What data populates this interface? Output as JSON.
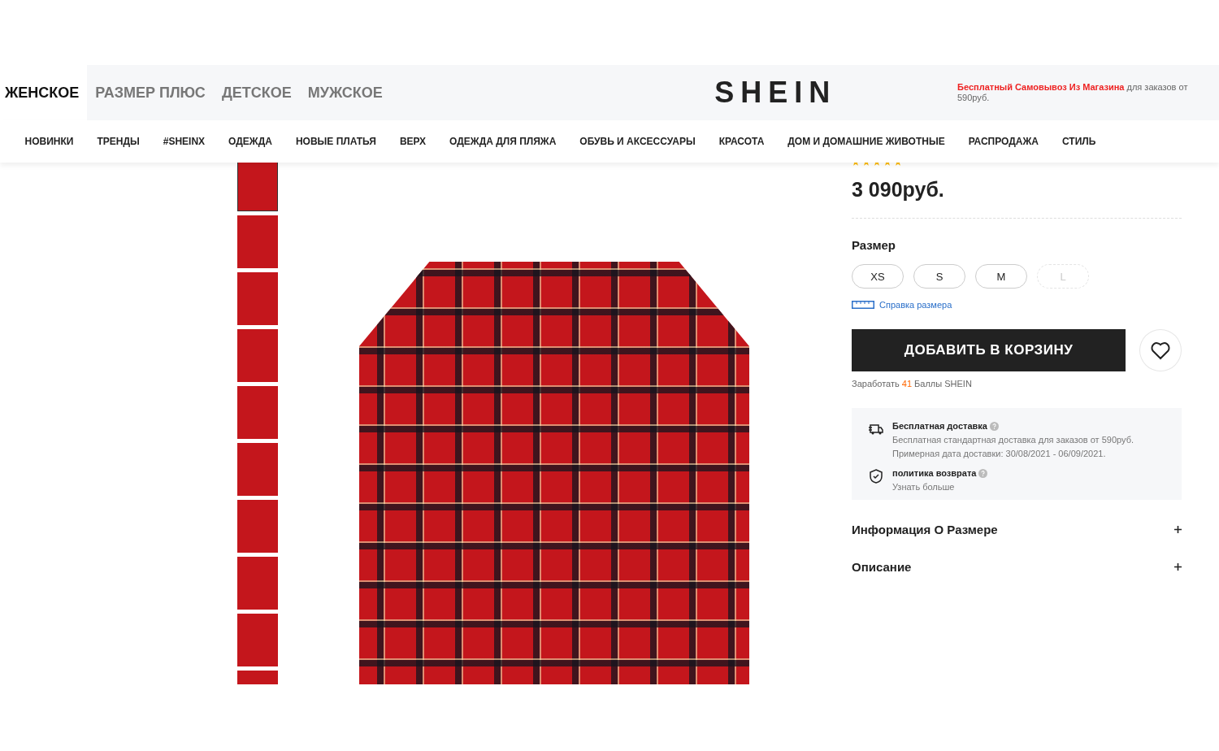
{
  "header": {
    "channels": [
      {
        "label": "ЖЕНСКОЕ",
        "selected": true
      },
      {
        "label": "РАЗМЕР ПЛЮС",
        "selected": false
      },
      {
        "label": "ДЕТСКОЕ",
        "selected": false
      },
      {
        "label": "МУЖСКОЕ",
        "selected": false
      }
    ],
    "logo": "SHEIN",
    "promo": {
      "highlight": "Бесплатный Самовывоз Из Магазина",
      "text": "для заказов от 590руб."
    }
  },
  "nav": [
    "НОВИНКИ",
    "ТРЕНДЫ",
    "#SHEINX",
    "ОДЕЖДА",
    "НОВЫЕ ПЛАТЬЯ",
    "ВЕРХ",
    "ОДЕЖДА ДЛЯ ПЛЯЖА",
    "ОБУВЬ И АКСЕССУАРЫ",
    "КРАСОТА",
    "ДОМ И ДОМАШНИЕ ЖИВОТНЫЕ",
    "РАСПРОДАЖА",
    "СТИЛЬ"
  ],
  "gallery": {
    "thumbnails": [
      {
        "selected": true
      },
      {
        "selected": false
      },
      {
        "selected": false
      },
      {
        "selected": false
      },
      {
        "selected": false
      },
      {
        "selected": false
      },
      {
        "selected": false
      },
      {
        "selected": false
      },
      {
        "selected": false
      },
      {
        "selected": false
      }
    ]
  },
  "product": {
    "stars": 5,
    "price": "3 090руб.",
    "size_label": "Размер",
    "sizes": [
      {
        "label": "XS",
        "disabled": false
      },
      {
        "label": "S",
        "disabled": false
      },
      {
        "label": "M",
        "disabled": false
      },
      {
        "label": "L",
        "disabled": true
      }
    ],
    "size_guide": "Справка размера",
    "add_to_cart": "ДОБАВИТЬ В КОРЗИНУ",
    "points": {
      "prefix": "Заработать",
      "value": "41",
      "suffix": "Баллы SHEIN"
    },
    "services": [
      {
        "kind": "delivery",
        "title": "Бесплатная доставка",
        "lines": [
          "Бесплатная стандартная доставка для заказов от 590руб.",
          "Примерная дата доставки: 30/08/2021 - 06/09/2021."
        ]
      },
      {
        "kind": "returns",
        "title": "политика возврата",
        "lines": [
          "Узнать больше"
        ]
      }
    ],
    "sections": [
      {
        "title": "Информация О Размере",
        "expanded": false
      },
      {
        "title": "Описание",
        "expanded": false
      }
    ]
  }
}
